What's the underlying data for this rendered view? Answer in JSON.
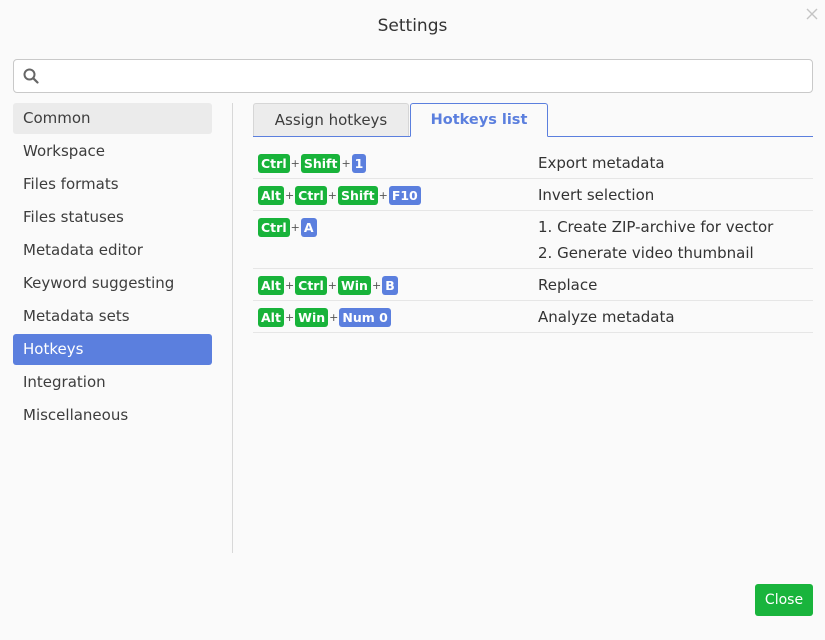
{
  "dialog": {
    "title": "Settings",
    "close_icon": "close-icon",
    "close_button_label": "Close"
  },
  "search": {
    "placeholder": "",
    "value": "",
    "icon": "search-icon"
  },
  "sidebar": {
    "items": [
      {
        "label": "Common"
      },
      {
        "label": "Workspace"
      },
      {
        "label": "Files formats"
      },
      {
        "label": "Files statuses"
      },
      {
        "label": "Metadata editor"
      },
      {
        "label": "Keyword suggesting"
      },
      {
        "label": "Metadata sets"
      },
      {
        "label": "Hotkeys"
      },
      {
        "label": "Integration"
      },
      {
        "label": "Miscellaneous"
      }
    ],
    "active_index": 7
  },
  "tabs": {
    "items": [
      {
        "label": "Assign hotkeys"
      },
      {
        "label": "Hotkeys list"
      }
    ],
    "active_index": 1
  },
  "hotkeys": [
    {
      "keys": [
        {
          "label": "Ctrl",
          "kind": "mod"
        },
        {
          "label": "Shift",
          "kind": "mod"
        },
        {
          "label": "1",
          "kind": "main"
        }
      ],
      "actions": [
        "Export metadata"
      ]
    },
    {
      "keys": [
        {
          "label": "Alt",
          "kind": "mod"
        },
        {
          "label": "Ctrl",
          "kind": "mod"
        },
        {
          "label": "Shift",
          "kind": "mod"
        },
        {
          "label": "F10",
          "kind": "main"
        }
      ],
      "actions": [
        "Invert selection"
      ]
    },
    {
      "keys": [
        {
          "label": "Ctrl",
          "kind": "mod"
        },
        {
          "label": "A",
          "kind": "main"
        }
      ],
      "actions": [
        "1. Create ZIP-archive for vector",
        "2. Generate video thumbnail"
      ]
    },
    {
      "keys": [
        {
          "label": "Alt",
          "kind": "mod"
        },
        {
          "label": "Ctrl",
          "kind": "mod"
        },
        {
          "label": "Win",
          "kind": "mod"
        },
        {
          "label": "B",
          "kind": "main"
        }
      ],
      "actions": [
        "Replace"
      ]
    },
    {
      "keys": [
        {
          "label": "Alt",
          "kind": "mod"
        },
        {
          "label": "Win",
          "kind": "mod"
        },
        {
          "label": "Num 0",
          "kind": "main"
        }
      ],
      "actions": [
        "Analyze metadata"
      ]
    }
  ],
  "plus_sign": "+",
  "colors": {
    "accent": "#5b7fde",
    "modifier_key": "#18b33a",
    "close_button": "#19b43c"
  }
}
